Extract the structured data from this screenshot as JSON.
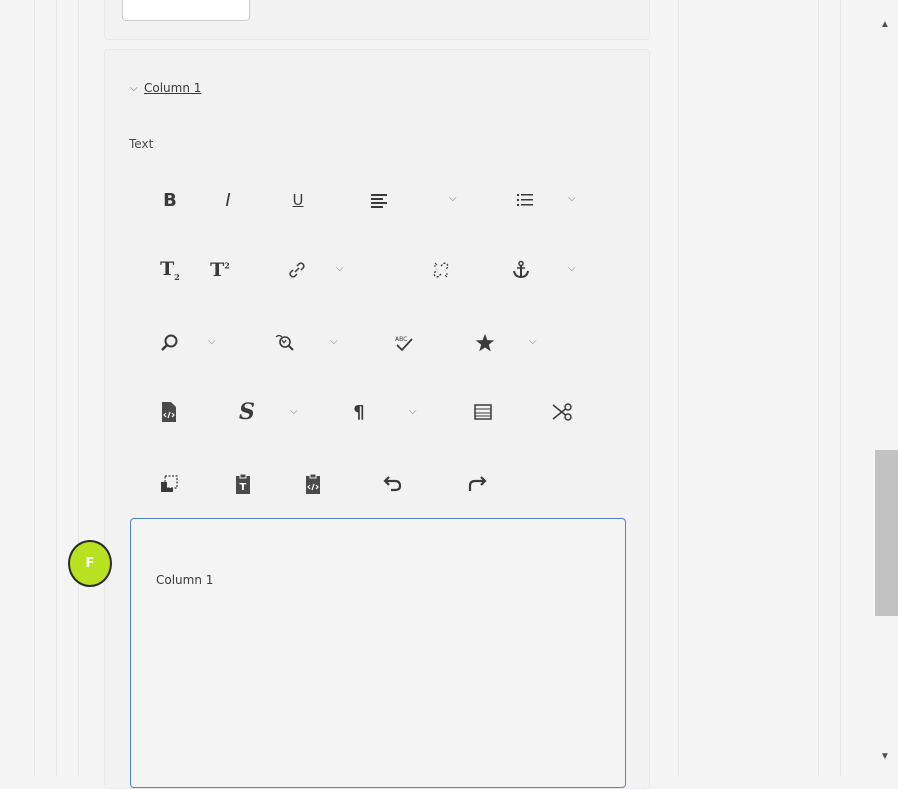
{
  "section": {
    "title": "Column 1",
    "chevron_icon": "chevron-down-icon"
  },
  "field_label": "Text",
  "toolbar": [
    {
      "name": "bold-button",
      "icon": "bold-icon"
    },
    {
      "name": "italic-button",
      "icon": "italic-icon"
    },
    {
      "name": "underline-button",
      "icon": "underline-icon"
    },
    {
      "name": "align-button",
      "icon": "align-icon",
      "dropdown": true
    },
    {
      "name": "list-button",
      "icon": "list-icon",
      "dropdown": true
    },
    {
      "name": "subscript-button",
      "icon": "subscript-icon"
    },
    {
      "name": "superscript-button",
      "icon": "superscript-icon"
    },
    {
      "name": "link-button",
      "icon": "link-icon",
      "dropdown": true
    },
    {
      "name": "unlink-button",
      "icon": "unlink-icon"
    },
    {
      "name": "anchor-button",
      "icon": "anchor-icon",
      "dropdown": true
    },
    {
      "name": "find-button",
      "icon": "search-icon",
      "dropdown": true
    },
    {
      "name": "find-replace-button",
      "icon": "find-replace-icon",
      "dropdown": true
    },
    {
      "name": "spellcheck-button",
      "icon": "spellcheck-icon"
    },
    {
      "name": "special-chars-button",
      "icon": "star-icon",
      "dropdown": true
    },
    {
      "name": "source-edit-button",
      "icon": "source-icon"
    },
    {
      "name": "styles-button",
      "icon": "styles-icon",
      "dropdown": true
    },
    {
      "name": "paragraph-button",
      "icon": "pilcrow-icon",
      "dropdown": true
    },
    {
      "name": "table-button",
      "icon": "table-icon"
    },
    {
      "name": "cut-button",
      "icon": "scissors-icon"
    },
    {
      "name": "copy-button",
      "icon": "copy-icon"
    },
    {
      "name": "paste-text-button",
      "icon": "paste-text-icon"
    },
    {
      "name": "paste-source-button",
      "icon": "paste-source-icon"
    },
    {
      "name": "undo-button",
      "icon": "undo-icon"
    },
    {
      "name": "redo-button",
      "icon": "redo-icon"
    }
  ],
  "editor": {
    "content": "Column 1"
  },
  "badge": {
    "label": "F",
    "color": "#b8e11f"
  },
  "accent_color": "#4a86d8"
}
